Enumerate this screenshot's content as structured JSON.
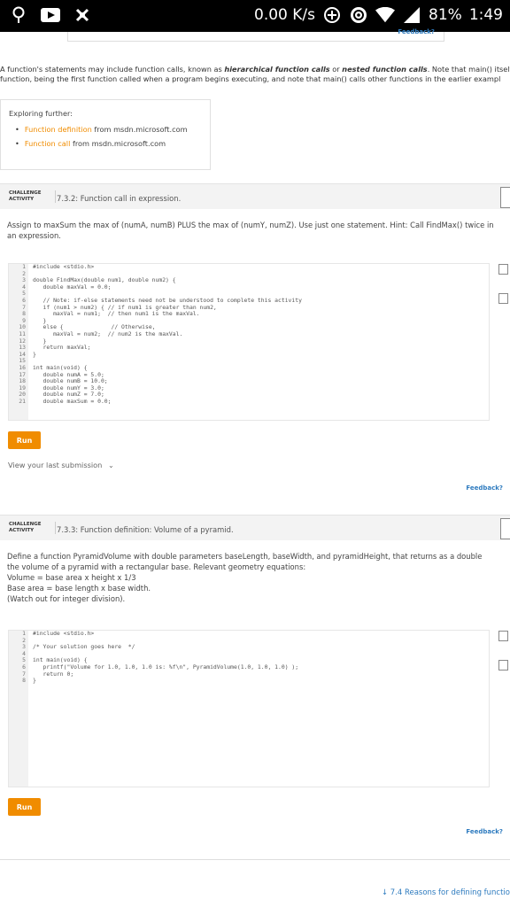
{
  "status": {
    "speed": "0.00 K/s",
    "battery": "81%",
    "time": "1:49",
    "icons": [
      "location-pin-icon",
      "youtube-icon",
      "dji-icon",
      "data-saver-icon",
      "hotspot-icon",
      "wifi-icon",
      "signal-icon"
    ]
  },
  "top_feedback": "Feedback?",
  "intro": {
    "line1_a": "A function's statements may include function calls, known as ",
    "line1_b": "hierarchical function calls",
    "line1_c": " or ",
    "line1_d": "nested function calls",
    "line1_e": ". Note that main() itself i",
    "line2": "function, being the first function called when a program begins executing, and note that main() calls other functions in the earlier exampl"
  },
  "explore": {
    "heading": "Exploring further:",
    "items": [
      {
        "link": "Function definition",
        "rest": " from msdn.microsoft.com"
      },
      {
        "link": "Function call",
        "rest": " from msdn.microsoft.com"
      }
    ]
  },
  "activity1": {
    "badge": "CHALLENGE ACTIVITY",
    "title": "7.3.2: Function call in expression.",
    "prompt": "Assign to maxSum the max of (numA, numB) PLUS the max of (numY, numZ). Use just one statement. Hint: Call FindMax() twice in an expression.",
    "code_lines": [
      "#include <stdio.h>",
      "",
      "double FindMax(double num1, double num2) {",
      "   double maxVal = 0.0;",
      "",
      "   // Note: if-else statements need not be understood to complete this activity",
      "   if (num1 > num2) { // if num1 is greater than num2,",
      "      maxVal = num1;  // then num1 is the maxVal.",
      "   }",
      "   else {              // Otherwise,",
      "      maxVal = num2;  // num2 is the maxVal.",
      "   }",
      "   return maxVal;",
      "}",
      "",
      "int main(void) {",
      "   double numA = 5.0;",
      "   double numB = 10.0;",
      "   double numY = 3.0;",
      "   double numZ = 7.0;",
      "   double maxSum = 0.0;"
    ],
    "run": "Run",
    "view_last": "View your last submission",
    "feedback": "Feedback?"
  },
  "activity2": {
    "badge": "CHALLENGE ACTIVITY",
    "title": "7.3.3: Function definition: Volume of a pyramid.",
    "prompt_lines": [
      "Define a function PyramidVolume with double parameters baseLength, baseWidth, and pyramidHeight, that returns as a double",
      "the volume of a pyramid with a rectangular base. Relevant geometry equations:",
      "Volume = base area x height x 1/3",
      "Base area = base length x base width.",
      "(Watch out for integer division)."
    ],
    "code_lines": [
      "#include <stdio.h>",
      "",
      "/* Your solution goes here  */",
      "",
      "int main(void) {",
      "   printf(\"Volume for 1.0, 1.0, 1.0 is: %f\\n\", PyramidVolume(1.0, 1.0, 1.0) );",
      "   return 0;",
      "}"
    ],
    "run": "Run",
    "feedback": "Feedback?"
  },
  "footer": "↓ 7.4 Reasons for defining functio"
}
